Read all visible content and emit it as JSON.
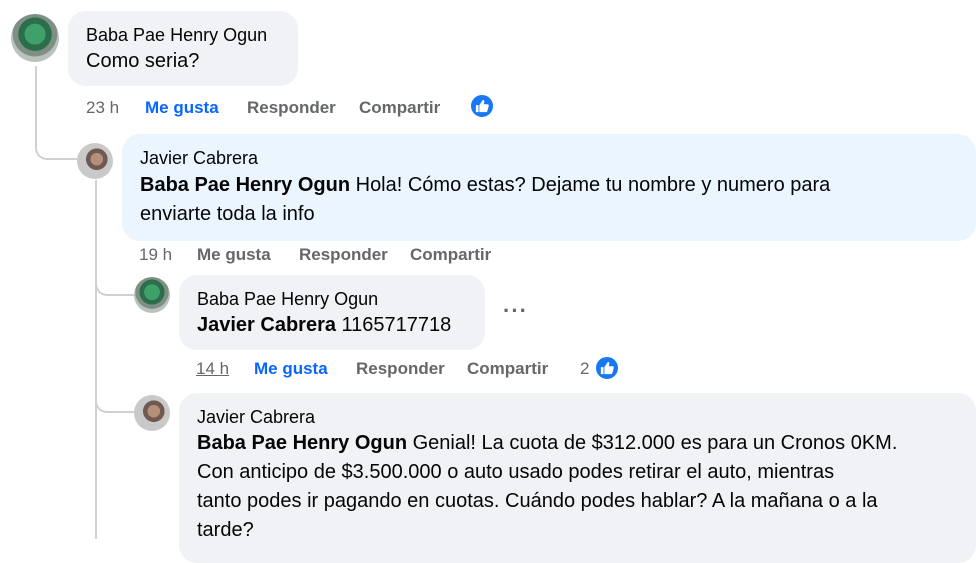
{
  "comments": [
    {
      "author": "Baba Pae Henry Ogun",
      "text": "Como seria?",
      "time": "23 h",
      "like_label": "Me gusta",
      "reply_label": "Responder",
      "share_label": "Compartir"
    },
    {
      "author": "Javier Cabrera",
      "mention": "Baba Pae Henry Ogun",
      "text_line1": " Hola! Cómo estas? Dejame tu nombre y numero para",
      "text_line2": "enviarte toda la info",
      "time": "19 h",
      "like_label": "Me gusta",
      "reply_label": "Responder",
      "share_label": "Compartir"
    },
    {
      "author": "Baba Pae Henry Ogun",
      "mention": "Javier Cabrera",
      "text": " 1165717718",
      "more_label": "···",
      "time": "14 h",
      "like_label": "Me gusta",
      "reply_label": "Responder",
      "share_label": "Compartir",
      "reaction_count": "2"
    },
    {
      "author": "Javier Cabrera",
      "mention": "Baba Pae Henry Ogun",
      "text_line1": " Genial! La cuota de $312.000 es para un Cronos 0KM.",
      "text_line2": "Con anticipo de $3.500.000 o auto usado podes retirar el auto, mientras",
      "text_line3": "tanto podes ir pagando en cuotas. Cuándo podes hablar? A la mañana o a la",
      "text_line4": "tarde?"
    }
  ],
  "colors": {
    "liked": "#0866ff",
    "muted": "#65676b",
    "bubble": "#f0f2f5",
    "bubble_highlight": "#ebf5ff",
    "like_badge": "#1877f2"
  }
}
